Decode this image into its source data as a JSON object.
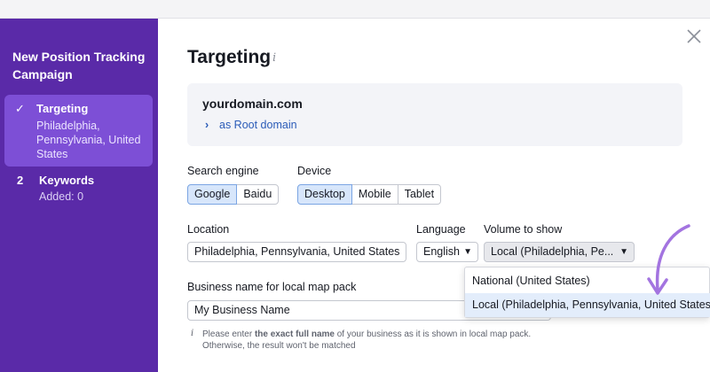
{
  "sidebar": {
    "title": "New Position Tracking Campaign",
    "steps": [
      {
        "label": "Targeting",
        "subtitle": "Philadelphia, Pennsylvania, United States",
        "status_icon": "check-icon",
        "check_glyph": "✓"
      },
      {
        "number": "2",
        "label": "Keywords",
        "subtitle": "Added: 0"
      }
    ]
  },
  "main": {
    "title": "Targeting",
    "info_glyph": "i",
    "domain": {
      "name": "yourdomain.com",
      "root_label": "as Root domain"
    },
    "search_engine": {
      "label": "Search engine",
      "options": [
        "Google",
        "Baidu"
      ],
      "selected": "Google"
    },
    "device": {
      "label": "Device",
      "options": [
        "Desktop",
        "Mobile",
        "Tablet"
      ],
      "selected": "Desktop"
    },
    "location": {
      "label": "Location",
      "value": "Philadelphia, Pennsylvania, United States"
    },
    "language": {
      "label": "Language",
      "value": "English"
    },
    "volume": {
      "label": "Volume to show",
      "value": "Local (Philadelphia, Pe...",
      "options": [
        "National (United States)",
        "Local (Philadelphia, Pennsylvania, United States)"
      ],
      "highlighted": "Local (Philadelphia, Pennsylvania, United States)"
    },
    "business": {
      "label": "Business name for local map pack",
      "value": "My Business Name"
    },
    "hint": {
      "glyph": "i",
      "before": "Please enter ",
      "bold": "the exact full name",
      "after": " of your business as it is shown in local map pack.",
      "line2": "Otherwise, the result won't be matched"
    }
  },
  "colors": {
    "sidebar_bg": "#5a2aa8",
    "active_step_bg": "#7d4fd6",
    "accent_link": "#2b5cb8",
    "selected_segment_bg": "#d7e6fb",
    "annotation_arrow": "#a374e0"
  }
}
